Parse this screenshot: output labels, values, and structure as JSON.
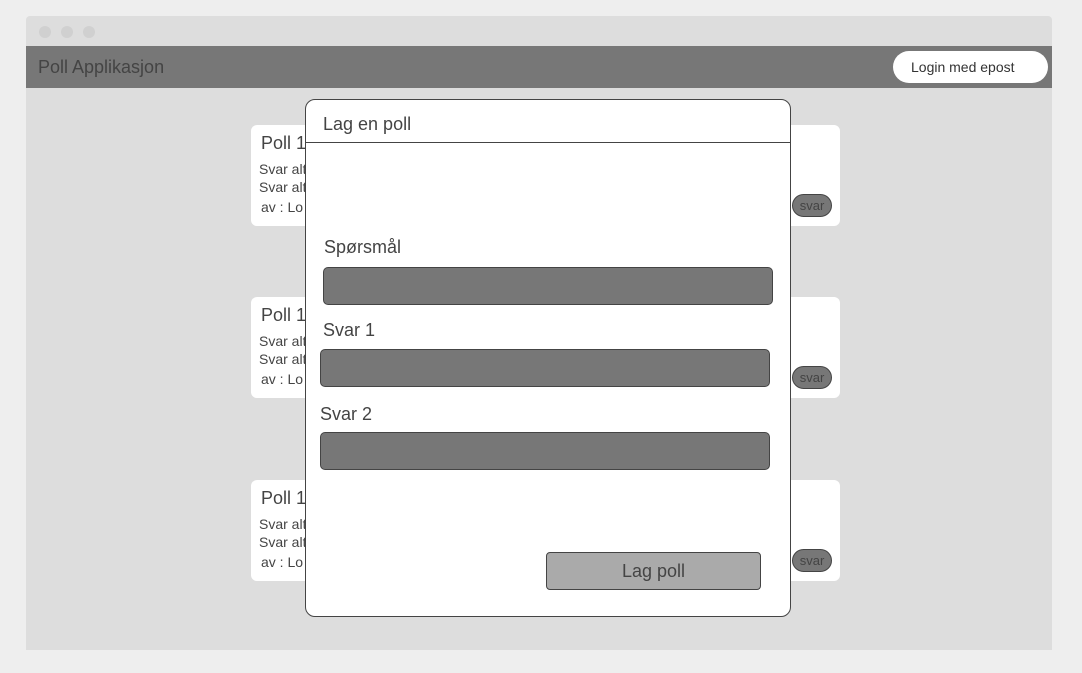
{
  "app": {
    "title": "Poll Applikasjon",
    "login_label": "Login med epost"
  },
  "polls": [
    {
      "title": "Poll 1",
      "answers": [
        "Svar alt",
        "Svar alt"
      ],
      "author": "av : Lo",
      "answer_label": "svar"
    },
    {
      "title": "Poll 1",
      "answers": [
        "Svar alt",
        "Svar alt"
      ],
      "author": "av : Lo",
      "answer_label": "svar"
    },
    {
      "title": "Poll 1",
      "answers": [
        "Svar alt",
        "Svar alt"
      ],
      "author": "av : Lo",
      "answer_label": "svar"
    }
  ],
  "modal": {
    "title": "Lag en poll",
    "question_label": "Spørsmål",
    "question_value": "",
    "answer1_label": "Svar 1",
    "answer1_value": "",
    "answer2_label": "Svar 2",
    "answer2_value": "",
    "submit_label": "Lag poll"
  },
  "colors": {
    "bar": "#777777",
    "background": "#dddddd",
    "card": "#ffffff",
    "input": "#777777",
    "submit": "#aaaaaa"
  }
}
